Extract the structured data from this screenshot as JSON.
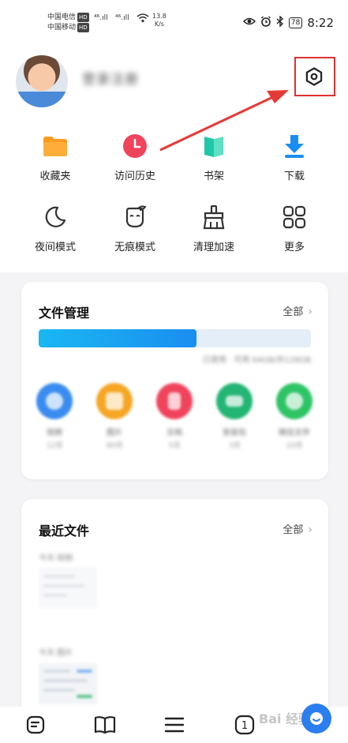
{
  "status_bar": {
    "carrier1": "中国电信",
    "carrier2": "中国移动",
    "hd_badge": "HD",
    "signal1": "⁴⁶.ıll",
    "signal2": "⁴⁶.ıll",
    "net_speed_value": "13.8",
    "net_speed_unit": "K/s",
    "battery": "78",
    "time": "8:22"
  },
  "profile": {
    "username": "登录注册"
  },
  "shortcuts": [
    {
      "label": "收藏夹",
      "icon": "folder-icon",
      "color": "#ff9a1f"
    },
    {
      "label": "访问历史",
      "icon": "clock-icon",
      "color": "#f0435c"
    },
    {
      "label": "书架",
      "icon": "book-icon",
      "color": "#20c7a8"
    },
    {
      "label": "下载",
      "icon": "download-icon",
      "color": "#1a8ef0"
    },
    {
      "label": "夜间模式",
      "icon": "moon-icon"
    },
    {
      "label": "无痕模式",
      "icon": "incognito-icon"
    },
    {
      "label": "清理加速",
      "icon": "broom-icon"
    },
    {
      "label": "更多",
      "icon": "more-grid-icon"
    }
  ],
  "file_management": {
    "title": "文件管理",
    "all_label": "全部",
    "storage_used_fraction": 0.58,
    "storage_text": "已使用 · 可用 64GB/共128GB",
    "categories": [
      {
        "name": "视频",
        "count": "12项",
        "color": "#3a8cf0"
      },
      {
        "name": "图片",
        "count": "86项",
        "color": "#f5a623"
      },
      {
        "name": "文档",
        "count": "5项",
        "color": "#f0435c"
      },
      {
        "name": "安装包",
        "count": "3项",
        "color": "#22b573"
      },
      {
        "name": "微信文件",
        "count": "20项",
        "color": "#2ec466"
      }
    ]
  },
  "recent_files": {
    "title": "最近文件",
    "all_label": "全部",
    "group1_label": "今天·视频",
    "group2_label": "今天·图片"
  },
  "watermark": "Bai 经验"
}
